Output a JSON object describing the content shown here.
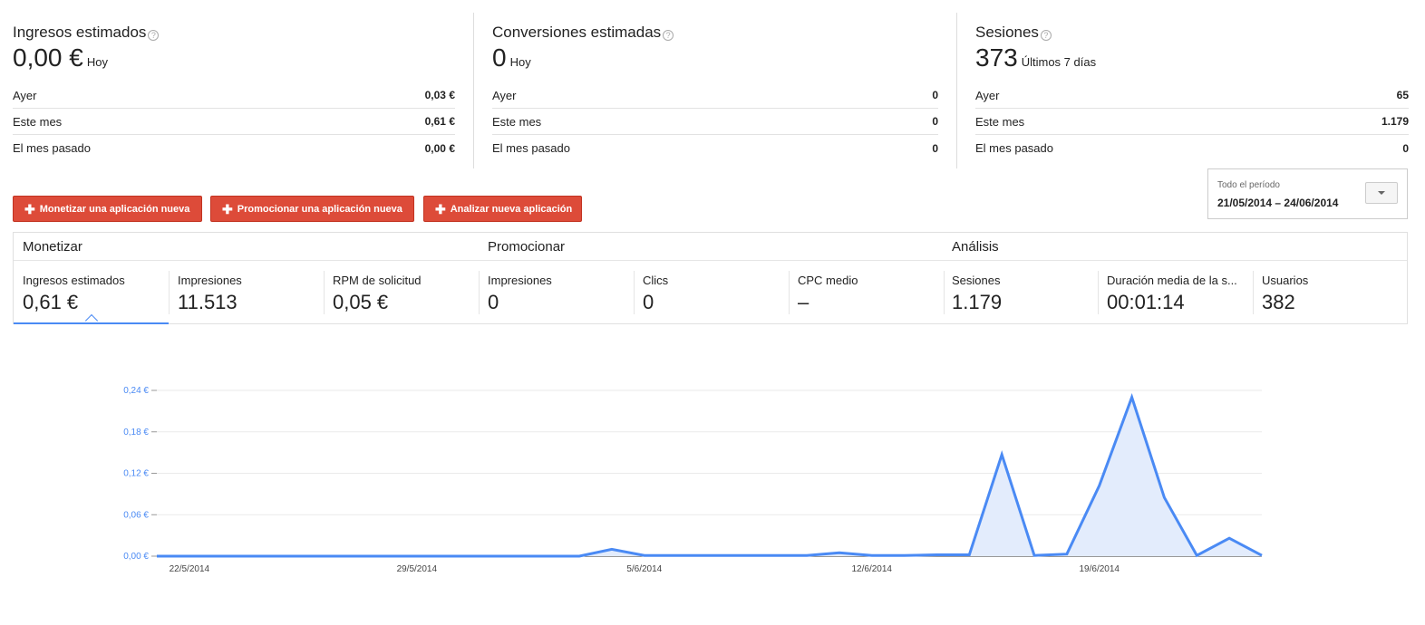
{
  "summary": [
    {
      "title": "Ingresos estimados",
      "value": "0,00 €",
      "sub": "Hoy",
      "rows": [
        {
          "label": "Ayer",
          "value": "0,03 €"
        },
        {
          "label": "Este mes",
          "value": "0,61 €"
        },
        {
          "label": "El mes pasado",
          "value": "0,00 €"
        }
      ]
    },
    {
      "title": "Conversiones estimadas",
      "value": "0",
      "sub": "Hoy",
      "rows": [
        {
          "label": "Ayer",
          "value": "0"
        },
        {
          "label": "Este mes",
          "value": "0"
        },
        {
          "label": "El mes pasado",
          "value": "0"
        }
      ]
    },
    {
      "title": "Sesiones",
      "value": "373",
      "sub": "Últimos 7 días",
      "rows": [
        {
          "label": "Ayer",
          "value": "65"
        },
        {
          "label": "Este mes",
          "value": "1.179"
        },
        {
          "label": "El mes pasado",
          "value": "0"
        }
      ]
    }
  ],
  "help_glyph": "?",
  "buttons": {
    "plus": "✚",
    "monetize": "Monetizar una aplicación nueva",
    "promote": "Promocionar una aplicación nueva",
    "analyze": "Analizar nueva aplicación"
  },
  "date_picker": {
    "label": "Todo el período",
    "range": "21/05/2014 – 24/06/2014"
  },
  "sections": {
    "monetize": "Monetizar",
    "promote": "Promocionar",
    "analysis": "Análisis"
  },
  "metrics": [
    {
      "label": "Ingresos estimados",
      "value": "0,61 €"
    },
    {
      "label": "Impresiones",
      "value": "11.513"
    },
    {
      "label": "RPM de solicitud",
      "value": "0,05 €"
    },
    {
      "label": "Impresiones",
      "value": "0"
    },
    {
      "label": "Clics",
      "value": "0"
    },
    {
      "label": "CPC medio",
      "value": "–"
    },
    {
      "label": "Sesiones",
      "value": "1.179"
    },
    {
      "label": "Duración media de la s...",
      "value": "00:01:14"
    },
    {
      "label": "Usuarios",
      "value": "382"
    }
  ],
  "colors": {
    "accent": "#4a8af4",
    "button": "#dd4b39",
    "area_fill": "#e3ecfc"
  },
  "chart_data": {
    "type": "area",
    "x": [
      "21/5/2014",
      "22/5/2014",
      "23/5/2014",
      "24/5/2014",
      "25/5/2014",
      "26/5/2014",
      "27/5/2014",
      "28/5/2014",
      "29/5/2014",
      "30/5/2014",
      "31/5/2014",
      "1/6/2014",
      "2/6/2014",
      "3/6/2014",
      "4/6/2014",
      "5/6/2014",
      "6/6/2014",
      "7/6/2014",
      "8/6/2014",
      "9/6/2014",
      "10/6/2014",
      "11/6/2014",
      "12/6/2014",
      "13/6/2014",
      "14/6/2014",
      "15/6/2014",
      "16/6/2014",
      "17/6/2014",
      "18/6/2014",
      "19/6/2014",
      "20/6/2014",
      "21/6/2014",
      "22/6/2014",
      "23/6/2014",
      "24/6/2014"
    ],
    "values": [
      0,
      0,
      0,
      0,
      0,
      0,
      0,
      0,
      0,
      0,
      0,
      0,
      0,
      0,
      0.01,
      0.001,
      0.001,
      0.001,
      0.001,
      0.001,
      0.001,
      0.005,
      0.001,
      0.001,
      0.002,
      0.002,
      0.147,
      0.001,
      0.003,
      0.102,
      0.23,
      0.085,
      0.001,
      0.026,
      0.001
    ],
    "y_ticks": [
      "0,00 €",
      "0,06 €",
      "0,12 €",
      "0,18 €",
      "0,24 €"
    ],
    "y_tick_values": [
      0,
      0.06,
      0.12,
      0.18,
      0.24
    ],
    "x_ticks": [
      "22/5/2014",
      "29/5/2014",
      "5/6/2014",
      "12/6/2014",
      "19/6/2014"
    ],
    "x_tick_index": [
      1,
      8,
      15,
      22,
      29
    ],
    "ylim": [
      0,
      0.24
    ],
    "grid": true
  }
}
